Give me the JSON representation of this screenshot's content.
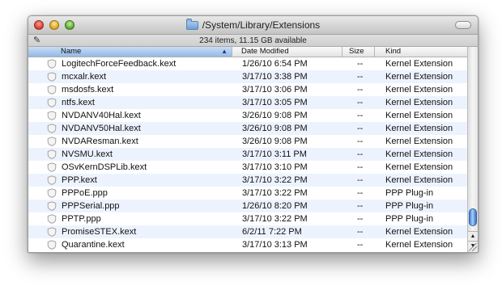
{
  "window": {
    "title": "/System/Library/Extensions",
    "status": "234 items, 11.15 GB available"
  },
  "columns": {
    "name": "Name",
    "date": "Date Modified",
    "size": "Size",
    "kind": "Kind"
  },
  "sort": {
    "column": "Name",
    "direction": "ascending"
  },
  "colors": {
    "row_alternate": "#edf3fe",
    "selected_header": "#93b8e6",
    "scroll_thumb": "#3f7ed6"
  },
  "files": [
    {
      "name": "LogitechForceFeedback.kext",
      "date": "1/26/10 6:54 PM",
      "size": "--",
      "kind": "Kernel Extension"
    },
    {
      "name": "mcxalr.kext",
      "date": "3/17/10 3:38 PM",
      "size": "--",
      "kind": "Kernel Extension"
    },
    {
      "name": "msdosfs.kext",
      "date": "3/17/10 3:06 PM",
      "size": "--",
      "kind": "Kernel Extension"
    },
    {
      "name": "ntfs.kext",
      "date": "3/17/10 3:05 PM",
      "size": "--",
      "kind": "Kernel Extension"
    },
    {
      "name": "NVDANV40Hal.kext",
      "date": "3/26/10 9:08 PM",
      "size": "--",
      "kind": "Kernel Extension"
    },
    {
      "name": "NVDANV50Hal.kext",
      "date": "3/26/10 9:08 PM",
      "size": "--",
      "kind": "Kernel Extension"
    },
    {
      "name": "NVDAResman.kext",
      "date": "3/26/10 9:08 PM",
      "size": "--",
      "kind": "Kernel Extension"
    },
    {
      "name": "NVSMU.kext",
      "date": "3/17/10 3:11 PM",
      "size": "--",
      "kind": "Kernel Extension"
    },
    {
      "name": "OSvKernDSPLib.kext",
      "date": "3/17/10 3:10 PM",
      "size": "--",
      "kind": "Kernel Extension"
    },
    {
      "name": "PPP.kext",
      "date": "3/17/10 3:22 PM",
      "size": "--",
      "kind": "Kernel Extension"
    },
    {
      "name": "PPPoE.ppp",
      "date": "3/17/10 3:22 PM",
      "size": "--",
      "kind": "PPP Plug-in"
    },
    {
      "name": "PPPSerial.ppp",
      "date": "1/26/10 8:20 PM",
      "size": "--",
      "kind": "PPP Plug-in"
    },
    {
      "name": "PPTP.ppp",
      "date": "3/17/10 3:22 PM",
      "size": "--",
      "kind": "PPP Plug-in"
    },
    {
      "name": "PromiseSTEX.kext",
      "date": "6/2/11 7:22 PM",
      "size": "--",
      "kind": "Kernel Extension"
    },
    {
      "name": "Quarantine.kext",
      "date": "3/17/10 3:13 PM",
      "size": "--",
      "kind": "Kernel Extension"
    }
  ]
}
